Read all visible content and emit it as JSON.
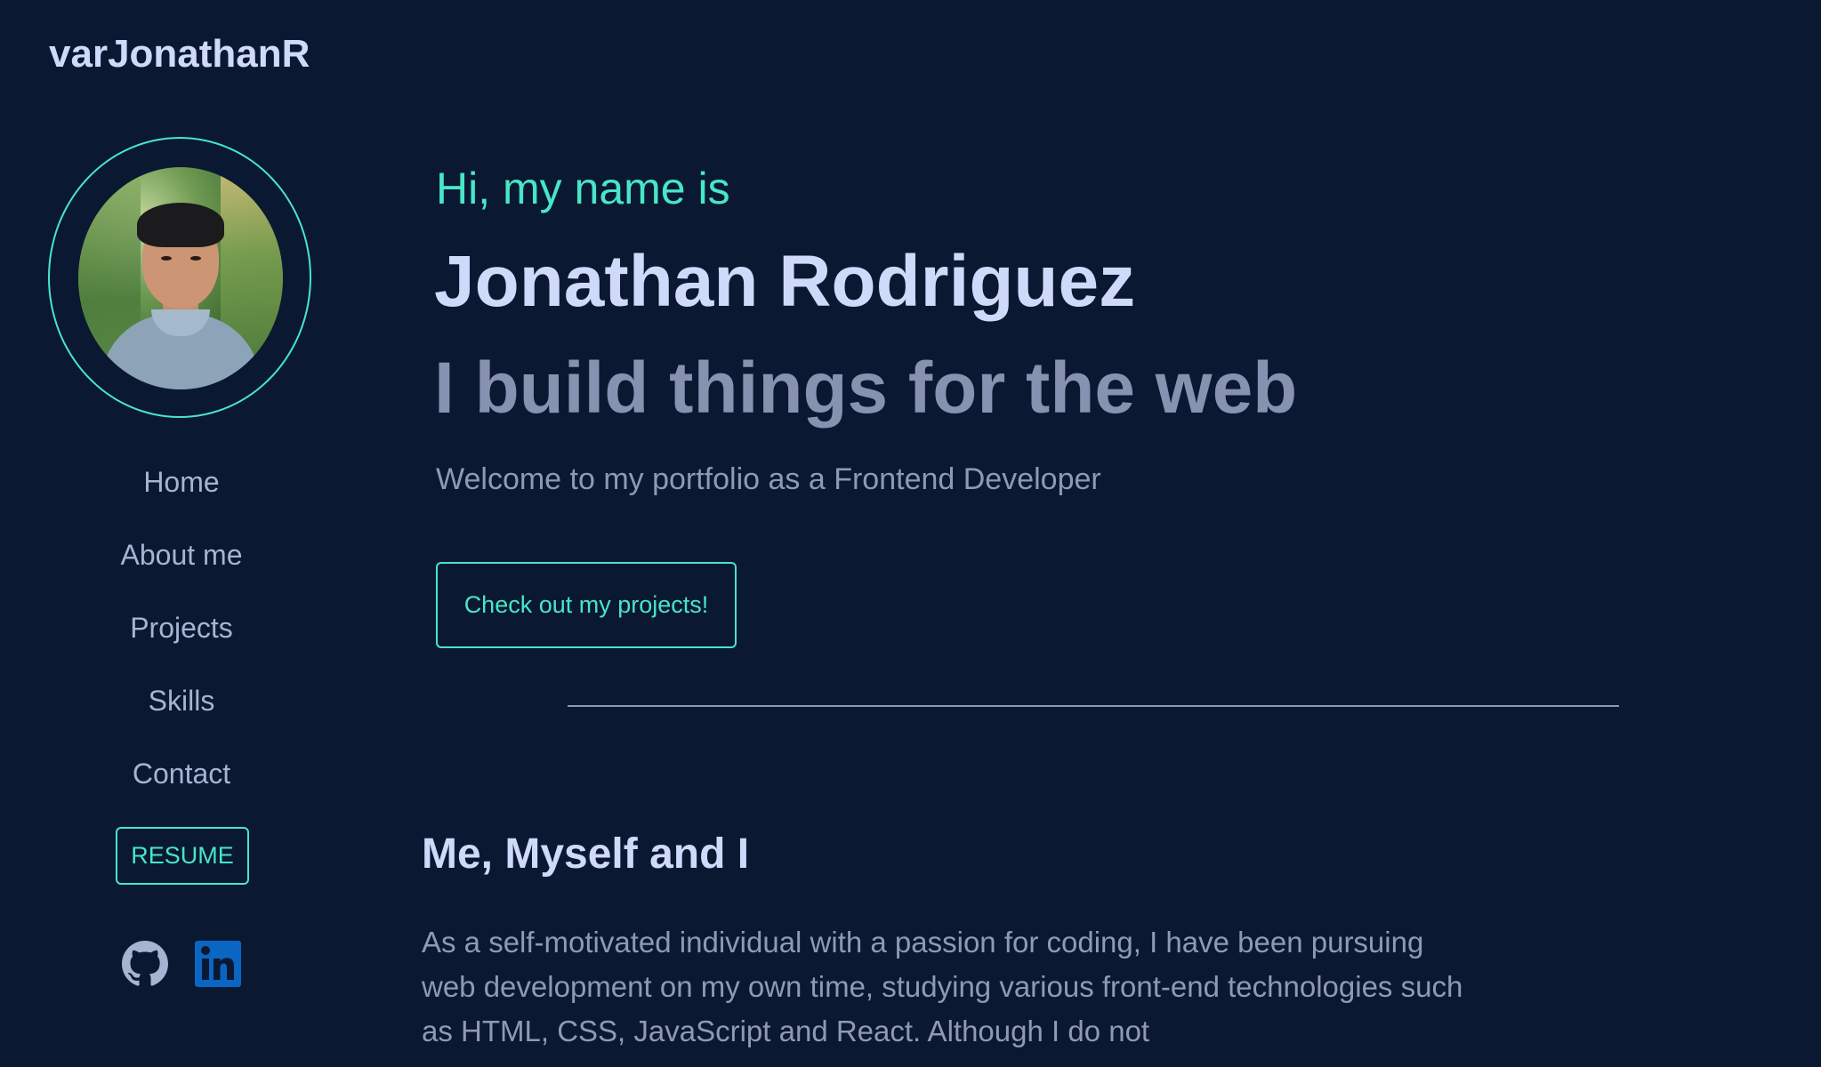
{
  "logo": "varJonathanR",
  "nav": {
    "items": [
      "Home",
      "About me",
      "Projects",
      "Skills",
      "Contact"
    ],
    "resume_label": "RESUME"
  },
  "social": {
    "github_icon": "github-icon",
    "linkedin_icon": "linkedin-icon",
    "linkedin_color": "#0a66c2"
  },
  "hero": {
    "intro": "Hi, my name is",
    "name": "Jonathan Rodriguez",
    "tagline": "I build things for the web",
    "subtitle": "Welcome to my portfolio as a Frontend Developer",
    "cta_label": "Check out my projects!"
  },
  "about": {
    "title": "Me, Myself and I",
    "body": "As a self-motivated individual with a passion for coding, I have been pursuing web development on my own time, studying various front-end technologies such as HTML, CSS, JavaScript and React. Although I do not"
  },
  "colors": {
    "background": "#0b1831",
    "accent": "#47e6c6",
    "heading": "#cfd9fa",
    "muted": "#8f99b7"
  }
}
